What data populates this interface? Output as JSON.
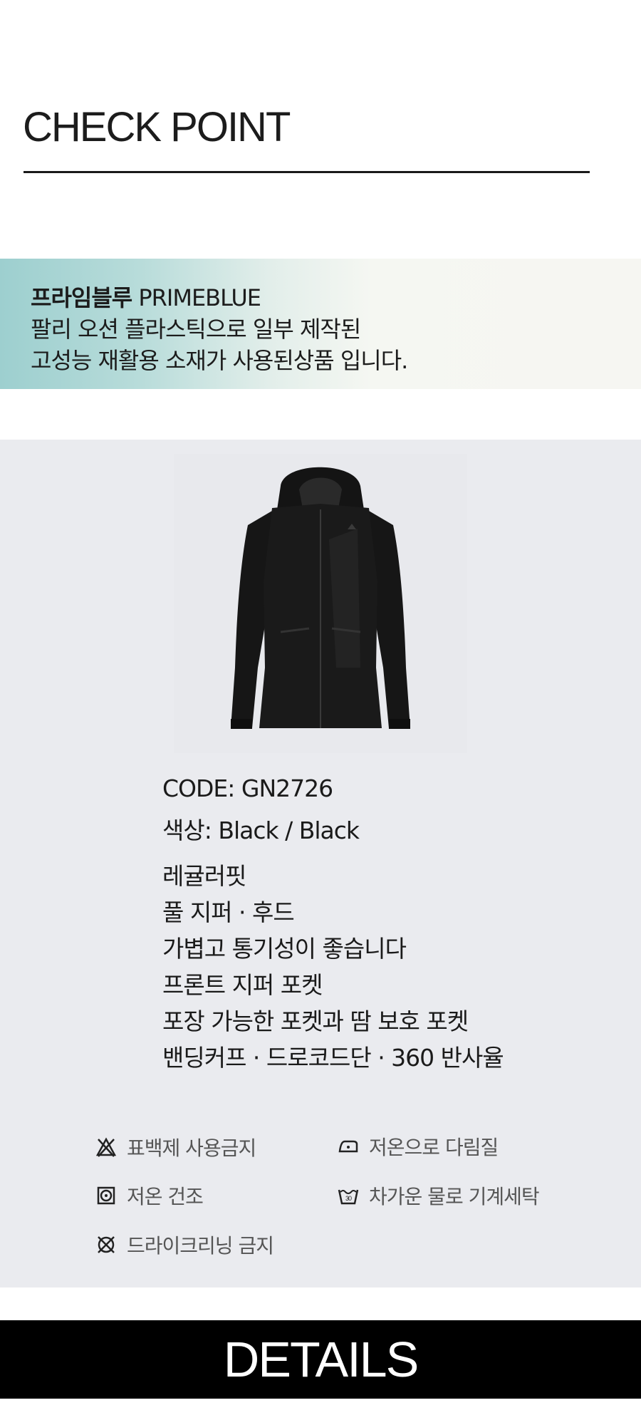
{
  "checkpoint": {
    "title": "CHECK POINT"
  },
  "banner": {
    "bold": "프라임블루",
    "english": " PRIMEBLUE",
    "line2": "팔리 오션 플라스틱으로 일부 제작된",
    "line3": "고성능 재활용 소재가 사용된상품 입니다."
  },
  "product": {
    "image_icon": "black-hooded-jacket",
    "code_label": "CODE: GN2726",
    "color_label": "색상:  Black / Black",
    "features": [
      "레귤러핏",
      "풀 지퍼 · 후드",
      "가볍고 통기성이 좋습니다",
      "프론트 지퍼 포켓",
      "포장 가능한 포켓과 땀 보호  포켓",
      "밴딩커프 · 드로코드단 · 360 반사율"
    ]
  },
  "care": {
    "items": [
      {
        "icon": "no-bleach-icon",
        "label": "표백제 사용금지"
      },
      {
        "icon": "low-iron-icon",
        "label": "저온으로 다림질"
      },
      {
        "icon": "tumble-dry-low-icon",
        "label": "저온 건조"
      },
      {
        "icon": "machine-wash-cold-icon",
        "label": "차가운 물로 기계세탁"
      },
      {
        "icon": "no-dry-clean-icon",
        "label": "드라이크리닝 금지"
      }
    ]
  },
  "details": {
    "title": "DETAILS"
  }
}
